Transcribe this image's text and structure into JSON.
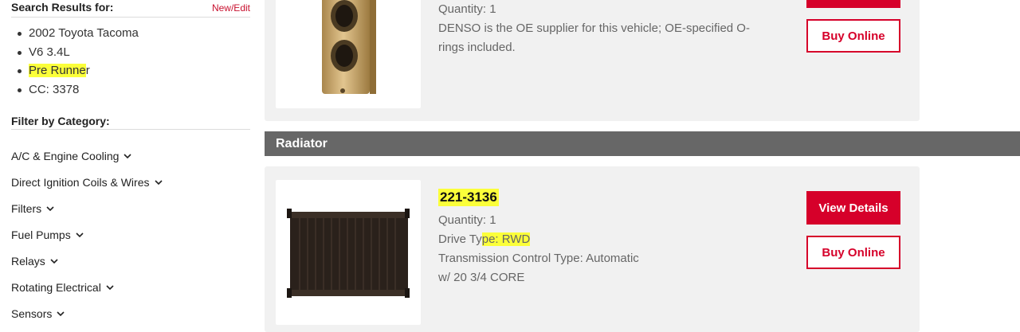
{
  "sidebar": {
    "search_title": "Search Results for:",
    "new_edit": "New/Edit",
    "vehicle": [
      "2002 Toyota Tacoma",
      "V6 3.4L"
    ],
    "trim": {
      "highlighted": "Pre Runne",
      "rest": "r"
    },
    "cc": "CC: 3378",
    "filter_title": "Filter by Category:",
    "categories": [
      "A/C & Engine Cooling",
      "Direct Ignition Coils & Wires",
      "Filters",
      "Fuel Pumps",
      "Relays",
      "Rotating Electrical",
      "Sensors"
    ]
  },
  "results": {
    "top": {
      "quantity": "Quantity: 1",
      "description": "DENSO is the OE supplier for this vehicle; OE-specified O-rings included.",
      "buy_label": "Buy Online"
    },
    "section_title": "Radiator",
    "radiator": {
      "part_number": "221-3136",
      "quantity": "Quantity: 1",
      "drive_type_prefix": "Drive Ty",
      "drive_type_highlight": "pe: RWD",
      "transmission": "Transmission Control Type: Automatic",
      "core": "w/ 20 3/4 CORE",
      "view_label": "View Details",
      "buy_label": "Buy Online"
    }
  },
  "colors": {
    "accent": "#d6002a",
    "highlight": "#fbff3a",
    "section_bar": "#676767"
  },
  "icons": [
    "chevron-down-icon",
    "expansion-valve-image",
    "radiator-image"
  ]
}
